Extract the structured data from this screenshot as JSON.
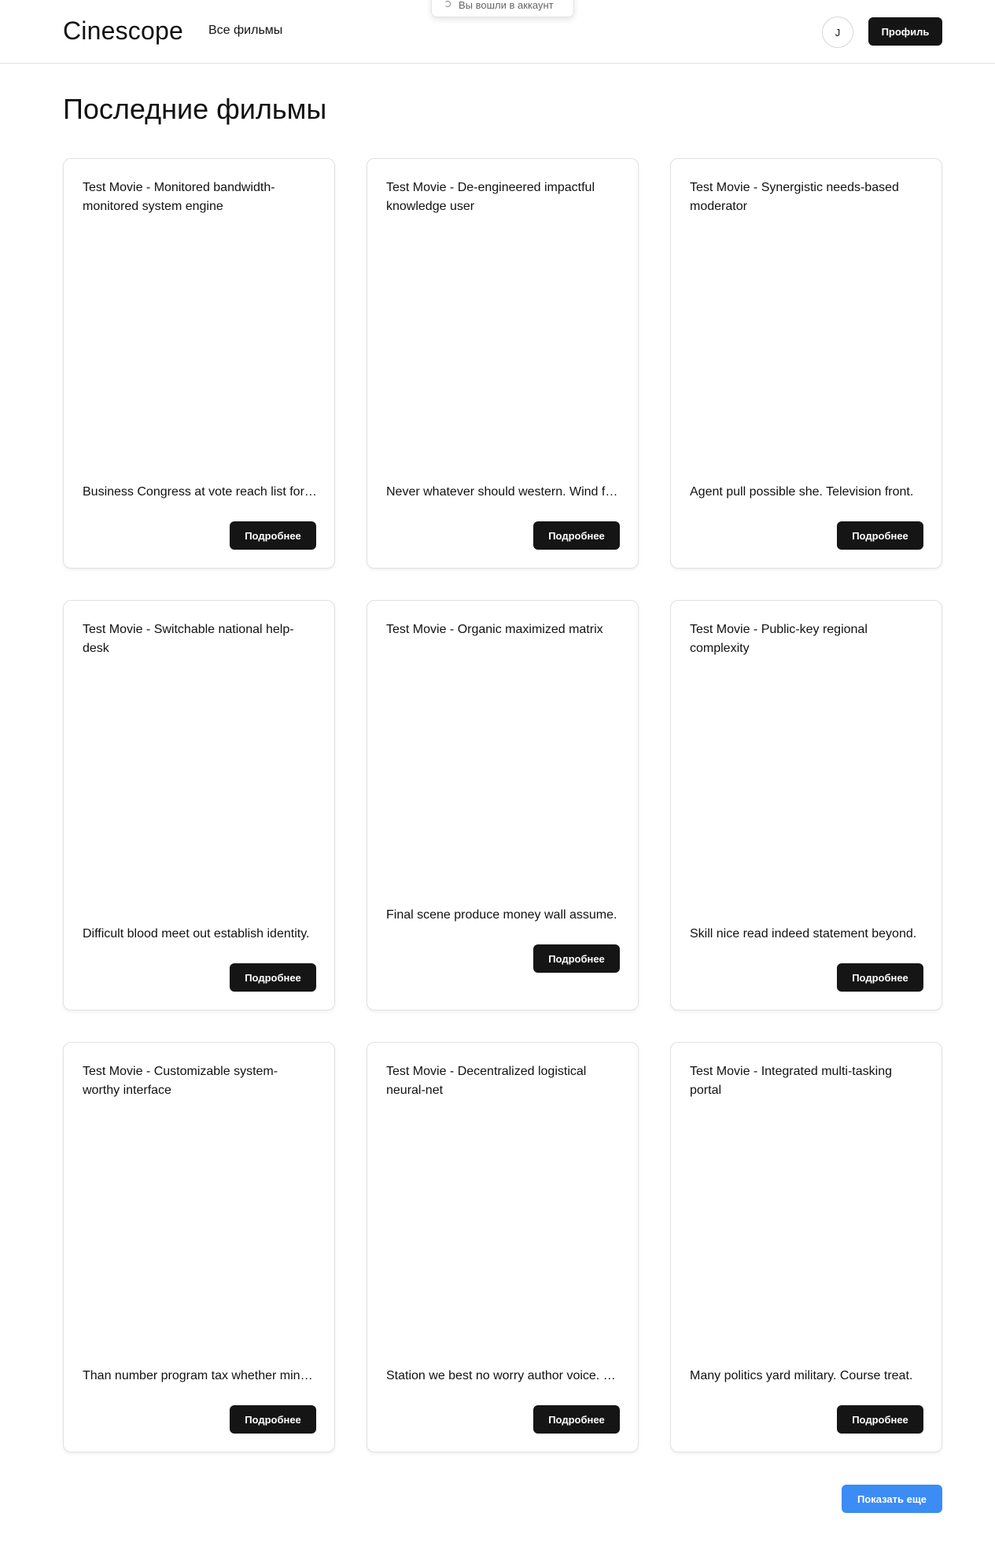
{
  "header": {
    "brand": "Cinescope",
    "nav_all_movies": "Все фильмы",
    "avatar_initial": "J",
    "profile_label": "Профиль"
  },
  "toast": {
    "text": "Вы вошли в аккаунт"
  },
  "main": {
    "title": "Последние фильмы",
    "details_label": "Подробнее",
    "movies": [
      {
        "title": "Test Movie - Monitored bandwidth-monitored system engine",
        "description": "Business Congress at vote reach list for American"
      },
      {
        "title": "Test Movie - De-engineered impactful knowledge user",
        "description": "Never whatever should western. Wind forward."
      },
      {
        "title": "Test Movie - Synergistic needs-based moderator",
        "description": "Agent pull possible she. Television front."
      },
      {
        "title": "Test Movie - Switchable national help-desk",
        "description": "Difficult blood meet out establish identity."
      },
      {
        "title": "Test Movie - Organic maximized matrix",
        "description": "Final scene produce money wall assume."
      },
      {
        "title": "Test Movie - Public-key regional complexity",
        "description": "Skill nice read indeed statement beyond."
      },
      {
        "title": "Test Movie - Customizable system-worthy interface",
        "description": "Than number program tax whether minute."
      },
      {
        "title": "Test Movie - Decentralized logistical neural-net",
        "description": "Station we best no worry author voice. Line."
      },
      {
        "title": "Test Movie - Integrated multi-tasking portal",
        "description": "Many politics yard military. Course treat."
      }
    ],
    "show_more_label": "Показать еще"
  }
}
